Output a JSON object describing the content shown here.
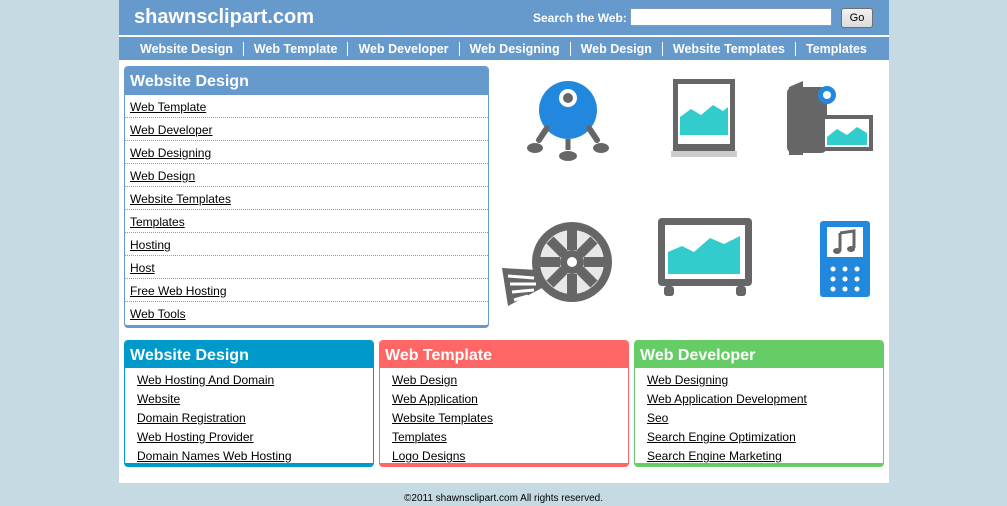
{
  "header": {
    "site_title": "shawnsclipart.com",
    "search_label": "Search the Web:",
    "search_value": "",
    "go_label": "Go"
  },
  "nav": [
    {
      "label": "Website Design"
    },
    {
      "label": "Web Template"
    },
    {
      "label": "Web Developer"
    },
    {
      "label": "Web Designing"
    },
    {
      "label": "Web Design"
    },
    {
      "label": "Website Templates"
    },
    {
      "label": "Templates"
    }
  ],
  "main_box": {
    "title": "Website Design",
    "links": [
      "Web Template",
      "Web Developer",
      "Web Designing",
      "Web Design",
      "Website Templates",
      "Templates",
      "Hosting",
      "Host",
      "Free Web Hosting",
      "Web Tools"
    ]
  },
  "boxes": [
    {
      "title": "Website Design",
      "links": [
        "Web Hosting And Domain",
        "Website",
        "Domain Registration",
        "Web Hosting Provider",
        "Domain Names Web Hosting"
      ]
    },
    {
      "title": "Web Template",
      "links": [
        "Web Design",
        "Web Application",
        "Website Templates",
        "Templates",
        "Logo Designs"
      ]
    },
    {
      "title": "Web Developer",
      "links": [
        "Web Designing",
        "Web Application Development",
        "Seo",
        "Search Engine Optimization",
        "Search Engine Marketing"
      ]
    }
  ],
  "icons": [
    "webcam-icon",
    "picture-frame-icon",
    "camera-photo-icon",
    "film-reel-icon",
    "monitor-icon",
    "music-player-icon"
  ],
  "colors": {
    "background": "#c6dae3",
    "header": "#6699cc",
    "box_blue": "#0099cc",
    "box_red": "#ff6666",
    "box_green": "#66cc66",
    "icon_cyan": "#33cccc",
    "icon_blue": "#2288dd",
    "icon_gray": "#666666"
  },
  "footer": {
    "text": "©2011 shawnsclipart.com All rights reserved."
  }
}
